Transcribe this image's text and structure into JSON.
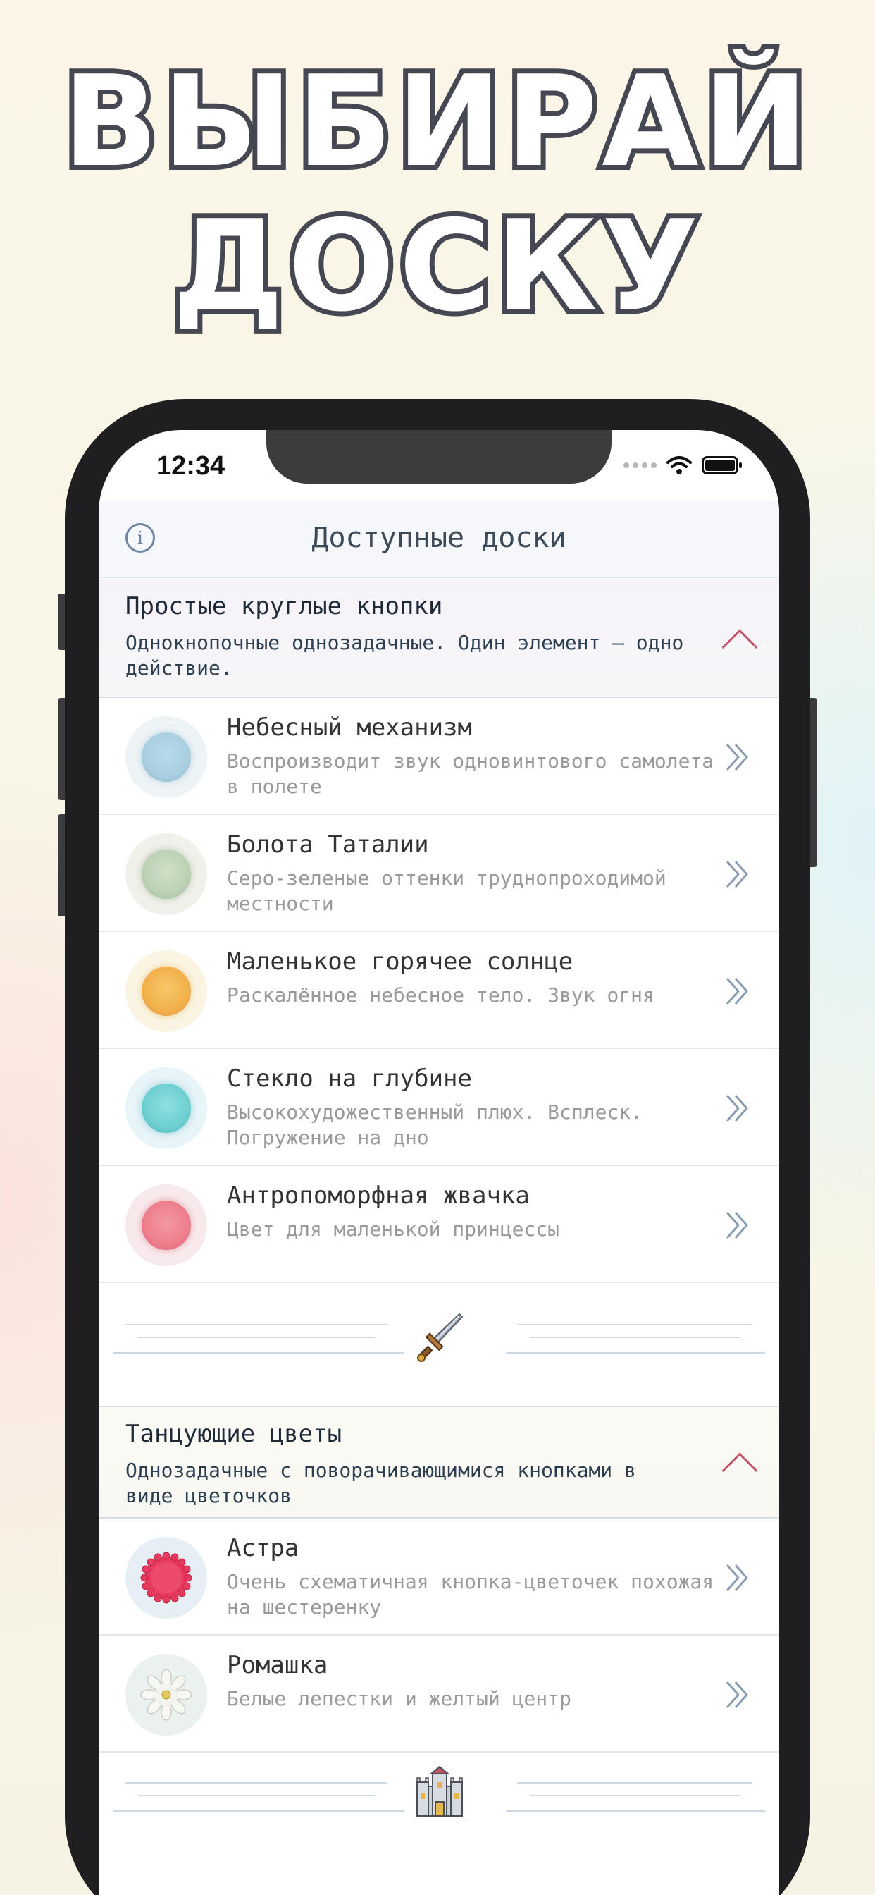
{
  "hero": {
    "line1": "ВЫБИРАЙ",
    "line2": "ДОСКУ"
  },
  "status_bar": {
    "time": "12:34"
  },
  "nav": {
    "title": "Доступные доски",
    "info_icon": "info-icon"
  },
  "sections": [
    {
      "title": "Простые круглые кнопки",
      "description": "Однокнопочные однозадачные. Один элемент – одно действие.",
      "items": [
        {
          "title": "Небесный механизм",
          "subtitle": "Воспроизводит звук одновинтового самолета в полете",
          "color": "#a9cfe0",
          "halo": "#eef4f6"
        },
        {
          "title": "Болота Таталии",
          "subtitle": "Серо-зеленые оттенки труднопроходимой местности",
          "color": "#bcd2b4",
          "halo": "#f0f1ea"
        },
        {
          "title": "Маленькое горячее солнце",
          "subtitle": "Раскалённое небесное тело. Звук огня",
          "color": "#f2b04a",
          "halo": "#faf5e3"
        },
        {
          "title": "Стекло на глубине",
          "subtitle": "Высокохудожественный плюх. Всплеск. Погружение на дно",
          "color": "#6ecfd0",
          "halo": "#e7f4f8"
        },
        {
          "title": "Антропоморфная жвачка",
          "subtitle": "Цвет для маленькой принцессы",
          "color": "#ee7e8c",
          "halo": "#f8eaec"
        }
      ]
    },
    {
      "title": "Танцующие цветы",
      "description": "Однозадачные с поворачивающимися кнопками в виде цветочков",
      "items": [
        {
          "title": "Астра",
          "subtitle": "Очень схематичная кнопка-цветочек похожая на шестеренку",
          "color": "#e83a5e",
          "halo": "#e6f0f4"
        },
        {
          "title": "Ромашка",
          "subtitle": "Белые лепестки и желтый центр",
          "color": "#f4f4ee",
          "halo": "#eaf1ef"
        }
      ]
    }
  ],
  "icons": {
    "sword": "sword-icon",
    "castle": "castle-icon",
    "chevron": "double-chevron-right-icon"
  }
}
